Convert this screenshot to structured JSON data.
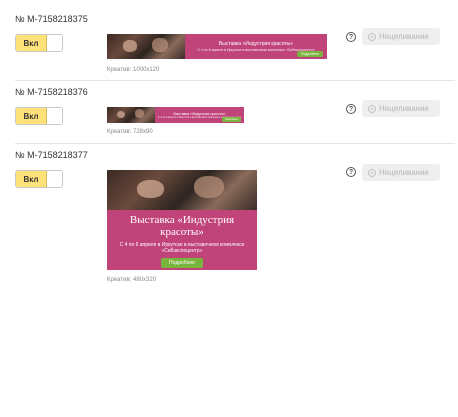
{
  "ads": [
    {
      "id": "№ M-7158218375",
      "toggle_label": "Вкл",
      "help_label": "?",
      "target_label": "Нацеливание",
      "banner": {
        "title": "Выставка «Индустрия красоты»",
        "subtitle": "С 4 по 6 апреля в Иркутске в выставочном комплексе «Сибэкспоцентр»",
        "button": "Подробнее"
      },
      "caption": "Креатив: 1000x120"
    },
    {
      "id": "№ M-7158218376",
      "toggle_label": "Вкл",
      "help_label": "?",
      "target_label": "Нацеливание",
      "banner": {
        "title": "Выставка «Индустрия красоты»",
        "subtitle": "С 4 по 6 апреля в Иркутске в выставочном комплексе «Сибэкспоцентр»",
        "button": "Подробнее"
      },
      "caption": "Креатив: 728x90"
    },
    {
      "id": "№ M-7158218377",
      "toggle_label": "Вкл",
      "help_label": "?",
      "target_label": "Нацеливание",
      "banner": {
        "title": "Выставка «Индустрия красоты»",
        "subtitle": "С 4 по 6 апреля в Иркутске в выставочном комплексе «Сибэкспоцентр»",
        "button": "Подробнее"
      },
      "caption": "Креатив: 480x320"
    }
  ],
  "colors": {
    "toggle_on": "#fde27a",
    "banner_bg": "#c0437a",
    "banner_button": "#79b43c",
    "disabled_button_bg": "#efefef",
    "disabled_text": "#b5b5b5"
  },
  "icons": [
    "help-icon",
    "target-icon"
  ]
}
